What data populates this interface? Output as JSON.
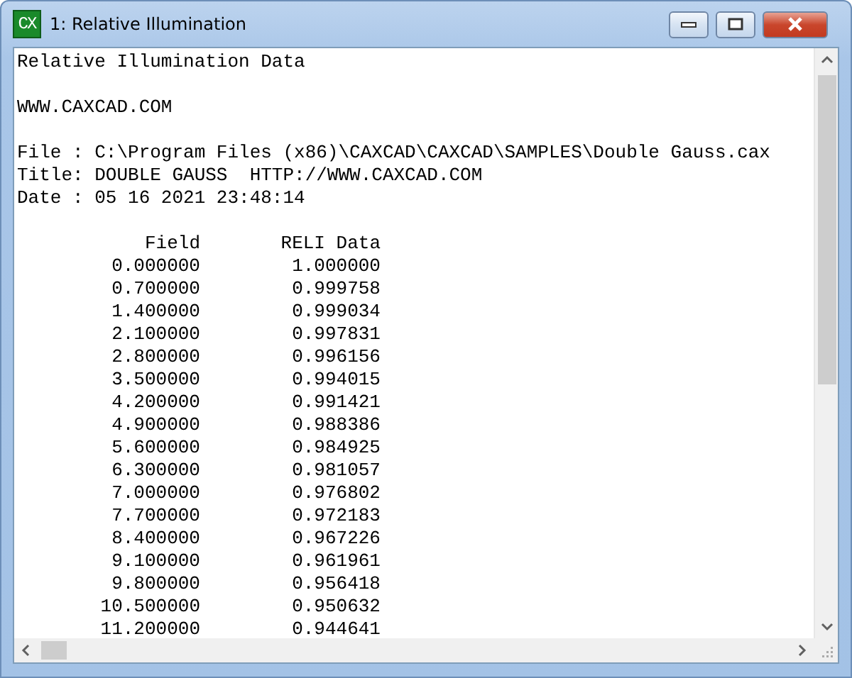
{
  "window": {
    "title": "1: Relative Illumination",
    "icon_text": "CX"
  },
  "header_blocks": [
    [
      "Relative Illumination Data"
    ],
    [
      "WWW.CAXCAD.COM"
    ],
    [
      "File : C:\\Program Files (x86)\\CAXCAD\\CAXCAD\\SAMPLES\\Double Gauss.cax",
      "Title: DOUBLE GAUSS  HTTP://WWW.CAXCAD.COM",
      "Date : 05 16 2021 23:48:14"
    ]
  ],
  "table": {
    "columns": [
      "Field",
      "RELI Data"
    ],
    "rows": [
      [
        "0.000000",
        "1.000000"
      ],
      [
        "0.700000",
        "0.999758"
      ],
      [
        "1.400000",
        "0.999034"
      ],
      [
        "2.100000",
        "0.997831"
      ],
      [
        "2.800000",
        "0.996156"
      ],
      [
        "3.500000",
        "0.994015"
      ],
      [
        "4.200000",
        "0.991421"
      ],
      [
        "4.900000",
        "0.988386"
      ],
      [
        "5.600000",
        "0.984925"
      ],
      [
        "6.300000",
        "0.981057"
      ],
      [
        "7.000000",
        "0.976802"
      ],
      [
        "7.700000",
        "0.972183"
      ],
      [
        "8.400000",
        "0.967226"
      ],
      [
        "9.100000",
        "0.961961"
      ],
      [
        "9.800000",
        "0.956418"
      ],
      [
        "10.500000",
        "0.950632"
      ],
      [
        "11.200000",
        "0.944641"
      ]
    ]
  }
}
